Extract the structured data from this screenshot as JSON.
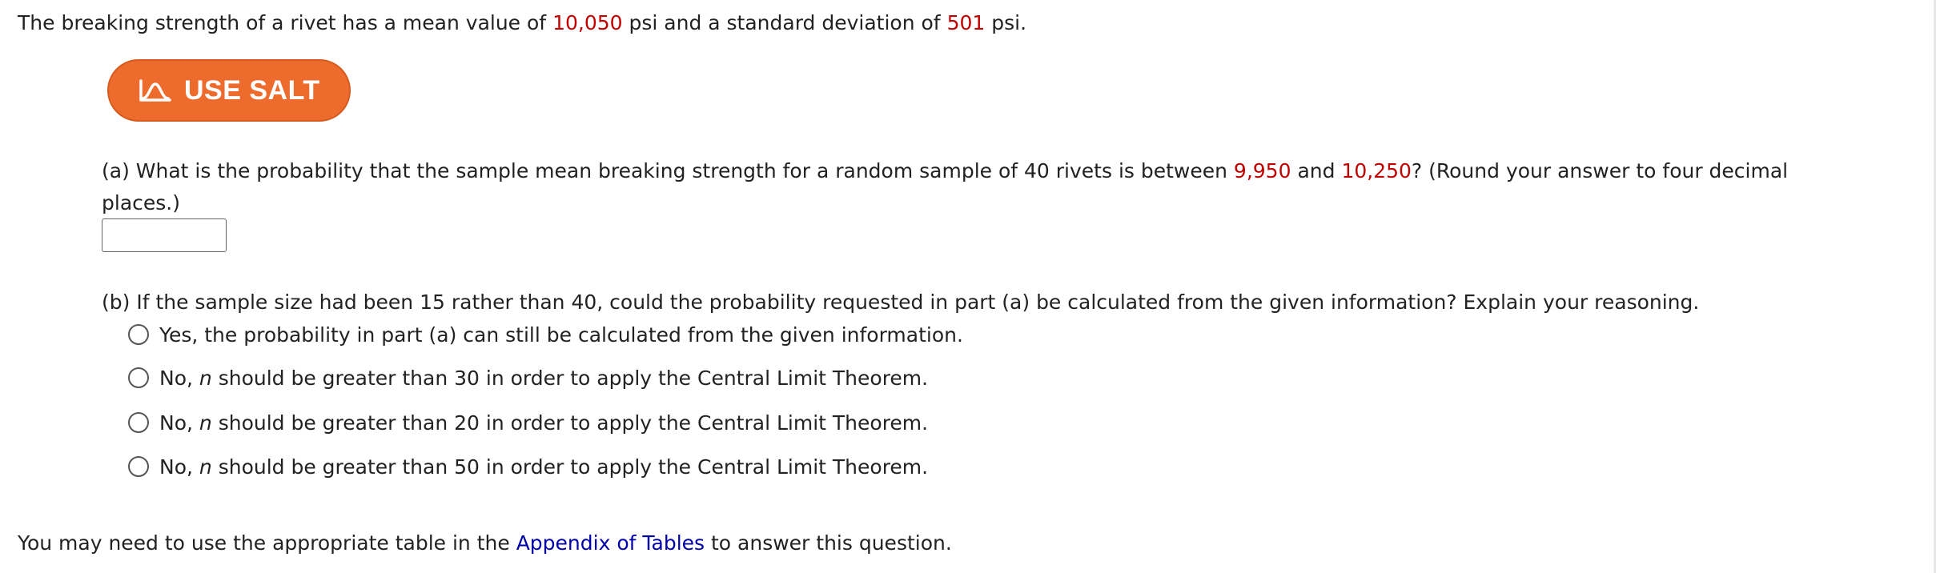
{
  "intro": {
    "prefix": "The breaking strength of a rivet has a mean value of ",
    "mean": "10,050",
    "middle": " psi and a standard deviation of ",
    "sd": "501",
    "suffix": " psi."
  },
  "salt_button": {
    "label": "USE SALT",
    "icon": "salt-bellcurve-icon",
    "color": "#ec6b2d"
  },
  "part_a": {
    "prefix": "(a) What is the probability that the sample mean breaking strength for a random sample of 40 rivets is between ",
    "low": "9,950",
    "and": " and ",
    "high": "10,250",
    "suffix": "? (Round your answer to four decimal",
    "line2": "places.)",
    "answer_value": ""
  },
  "part_b": {
    "question": "(b) If the sample size had been 15 rather than 40, could the probability requested in part (a) be calculated from the given information? Explain your reasoning.",
    "options": [
      {
        "label": "Yes, the probability in part (a) can still be calculated from the given information."
      },
      {
        "pre": "No, ",
        "var": "n",
        "post": " should be greater than 30 in order to apply the Central Limit Theorem."
      },
      {
        "pre": "No, ",
        "var": "n",
        "post": " should be greater than 20 in order to apply the Central Limit Theorem."
      },
      {
        "pre": "No, ",
        "var": "n",
        "post": " should be greater than 50 in order to apply the Central Limit Theorem."
      }
    ]
  },
  "footer": {
    "prefix": "You may need to use the appropriate table in the ",
    "link": "Appendix of Tables",
    "suffix": " to answer this question."
  },
  "colors": {
    "highlight": "#c00000",
    "link": "#0000aa",
    "accent": "#ec6b2d"
  }
}
